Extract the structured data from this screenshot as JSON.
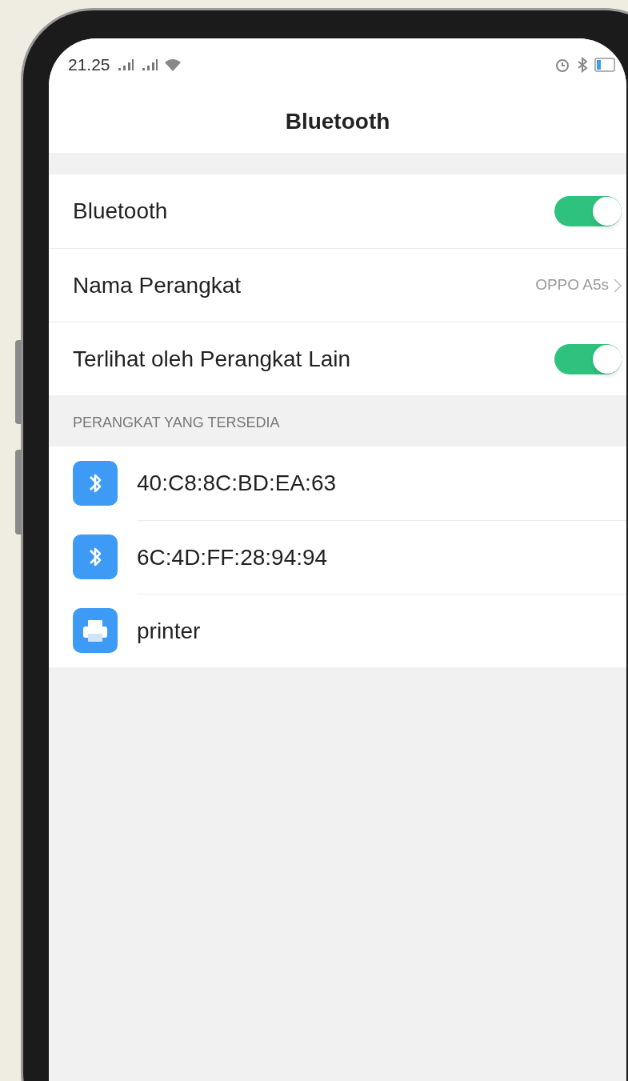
{
  "status_bar": {
    "time": "21.25"
  },
  "header": {
    "title": "Bluetooth"
  },
  "settings": [
    {
      "kind": "toggle",
      "label": "Bluetooth",
      "on": true
    },
    {
      "kind": "link",
      "label": "Nama Perangkat",
      "value": "OPPO A5s"
    },
    {
      "kind": "toggle",
      "label": "Terlihat oleh Perangkat Lain",
      "on": true
    }
  ],
  "available_section": {
    "title": "PERANGKAT YANG TERSEDIA",
    "devices": [
      {
        "kind": "bluetooth",
        "name": "40:C8:8C:BD:EA:63"
      },
      {
        "kind": "bluetooth",
        "name": "6C:4D:FF:28:94:94"
      },
      {
        "kind": "printer",
        "name": "printer"
      }
    ]
  }
}
